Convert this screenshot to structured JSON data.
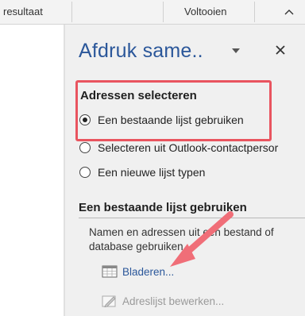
{
  "ribbon": {
    "left_label": "resultaat",
    "right_label": "Voltooien",
    "collapse_icon": "chevron-up-icon"
  },
  "pane": {
    "title": "Afdruk same..",
    "dropdown_icon": "dropdown-arrow-icon",
    "close_icon": "close-icon",
    "select_section": {
      "heading": "Adressen selecteren",
      "options": [
        {
          "label": "Een bestaande lijst gebruiken",
          "checked": true
        },
        {
          "label": "Selecteren uit Outlook-contactpersor",
          "checked": false
        },
        {
          "label": "Een nieuwe lijst typen",
          "checked": false
        }
      ]
    },
    "existing_section": {
      "heading": "Een bestaande lijst gebruiken",
      "description": "Namen en adressen uit een bestand of database gebruiken.",
      "browse_label": "Bladeren...",
      "edit_label": "Adreslijst bewerken..."
    }
  },
  "annotations": {
    "highlight_color": "#e9545f",
    "arrow_color": "#f06e78"
  }
}
